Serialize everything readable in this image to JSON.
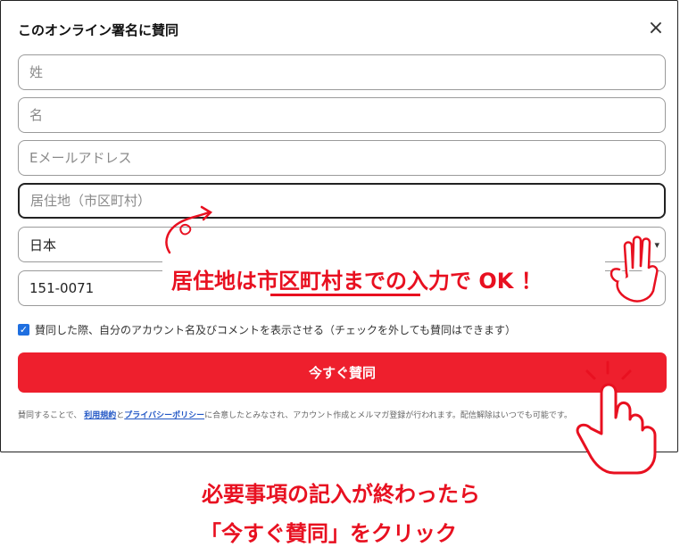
{
  "dialog": {
    "title": "このオンライン署名に賛同",
    "close_glyph": "×",
    "fields": {
      "last_name_placeholder": "姓",
      "first_name_placeholder": "名",
      "email_placeholder": "Eメールアドレス",
      "city_placeholder": "居住地（市区町村）",
      "country_value": "日本",
      "zip_value": "151-0071"
    },
    "consent": {
      "checked": true,
      "label": "賛同した際、自分のアカウント名及びコメントを表示させる（チェックを外しても賛同はできます）"
    },
    "submit_label": "今すぐ賛同",
    "terms": {
      "prefix": "賛同することで、",
      "link1": "利用規約",
      "and": "と",
      "link2": "プライバシーポリシー",
      "suffix": "に合意したとみなされ、アカウント作成とメルマガ登録が行われます。配信解除はいつでも可能です。"
    }
  },
  "annotations": {
    "callout": "居住地は市区町村までの入力で OK ！",
    "caption_line1": "必要事項の記入が終わったら",
    "caption_line2": "「今すぐ賛同」をクリック",
    "accent_color": "#e81020"
  }
}
